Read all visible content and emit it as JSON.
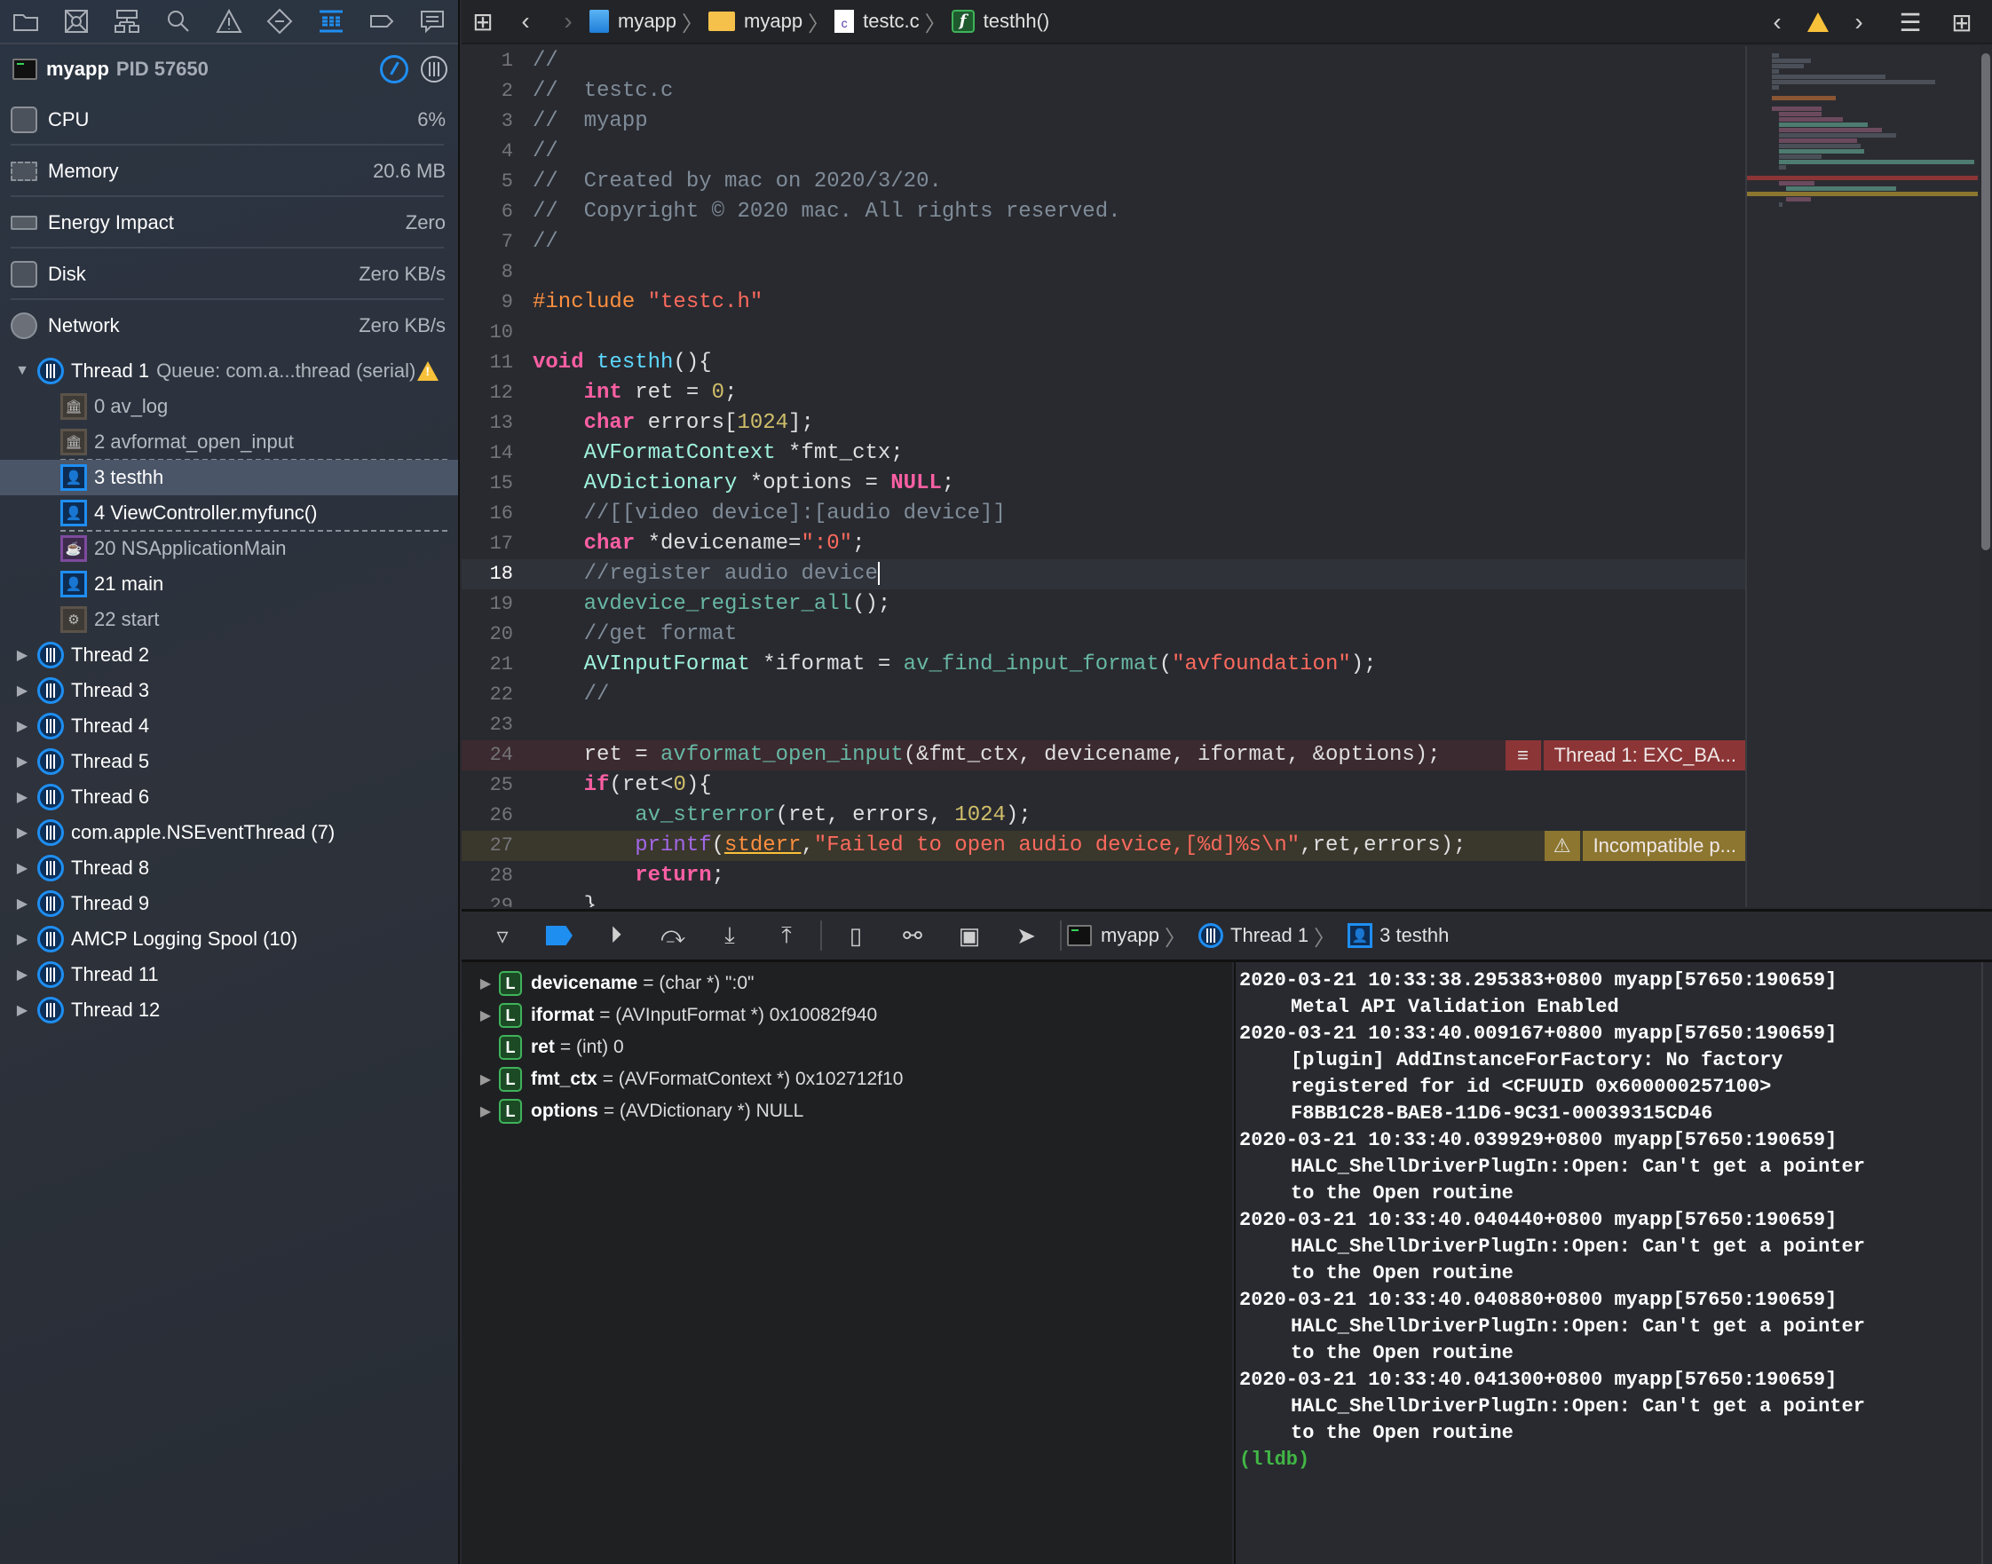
{
  "navigator": {
    "toolbar_icons": [
      "folder-icon",
      "source-control-icon",
      "symbol-icon",
      "find-icon",
      "issue-icon",
      "test-icon",
      "debug-icon",
      "breakpoint-icon",
      "report-icon"
    ],
    "active_icon": "debug-icon"
  },
  "process": {
    "name": "myapp",
    "pid": "PID 57650"
  },
  "gauges": [
    {
      "label": "CPU",
      "value": "6%",
      "icon": "cpu-icon"
    },
    {
      "label": "Memory",
      "value": "20.6 MB",
      "icon": "memory-icon"
    },
    {
      "label": "Energy Impact",
      "value": "Zero",
      "icon": "energy-icon"
    },
    {
      "label": "Disk",
      "value": "Zero KB/s",
      "icon": "disk-icon"
    },
    {
      "label": "Network",
      "value": "Zero KB/s",
      "icon": "network-icon"
    }
  ],
  "thread1": {
    "name": "Thread 1",
    "queue": "Queue: com.a...thread (serial)",
    "frames": [
      {
        "label": "0 av_log",
        "kind": "library"
      },
      {
        "label": "2 avformat_open_input",
        "kind": "library"
      },
      {
        "label": "3 testhh",
        "kind": "user",
        "selected": true
      },
      {
        "label": "4 ViewController.myfunc()",
        "kind": "user"
      },
      {
        "label": "20 NSApplicationMain",
        "kind": "framework"
      },
      {
        "label": "21 main",
        "kind": "user"
      },
      {
        "label": "22 start",
        "kind": "system"
      }
    ]
  },
  "threads": [
    "Thread 2",
    "Thread 3",
    "Thread 4",
    "Thread 5",
    "Thread 6",
    "com.apple.NSEventThread (7)",
    "Thread 8",
    "Thread 9",
    "AMCP Logging Spool (10)",
    "Thread 11",
    "Thread 12"
  ],
  "breadcrumb": {
    "project": "myapp",
    "folder": "myapp",
    "file": "testc.c",
    "file_icon_letter": "c",
    "symbol": "testhh()",
    "symbol_icon_letter": "f"
  },
  "code": {
    "current_line": 18,
    "lines": [
      {
        "n": "1",
        "html": "<span class='tok-cmt'>//</span>"
      },
      {
        "n": "2",
        "html": "<span class='tok-cmt'>//  testc.c</span>"
      },
      {
        "n": "3",
        "html": "<span class='tok-cmt'>//  myapp</span>"
      },
      {
        "n": "4",
        "html": "<span class='tok-cmt'>//</span>"
      },
      {
        "n": "5",
        "html": "<span class='tok-cmt'>//  Created by mac on 2020/3/20.</span>"
      },
      {
        "n": "6",
        "html": "<span class='tok-cmt'>//  Copyright © 2020 mac. All rights reserved.</span>"
      },
      {
        "n": "7",
        "html": "<span class='tok-cmt'>//</span>"
      },
      {
        "n": "8",
        "html": ""
      },
      {
        "n": "9",
        "html": "<span class='tok-pp'>#include</span> <span class='tok-str'>\"testc.h\"</span>"
      },
      {
        "n": "10",
        "html": ""
      },
      {
        "n": "11",
        "html": "<span class='tok-kw'>void</span> <span class='tok-decl'>testhh</span>(){"
      },
      {
        "n": "12",
        "html": "    <span class='tok-kw'>int</span> ret = <span class='tok-num'>0</span>;"
      },
      {
        "n": "13",
        "html": "    <span class='tok-kw'>char</span> errors[<span class='tok-num'>1024</span>];"
      },
      {
        "n": "14",
        "html": "    <span class='tok-type'>AVFormatContext</span> *fmt_ctx;"
      },
      {
        "n": "15",
        "html": "    <span class='tok-type'>AVDictionary</span> *options = <span class='tok-kw'>NULL</span>;"
      },
      {
        "n": "16",
        "html": "    <span class='tok-cmt'>//[[video device]:[audio device]]</span>"
      },
      {
        "n": "17",
        "html": "    <span class='tok-kw'>char</span> *devicename=<span class='tok-str'>\":0\"</span>;"
      },
      {
        "n": "18",
        "html": "    <span class='tok-cmt'>//register audio device</span><span class='caret'></span>",
        "state": "current"
      },
      {
        "n": "19",
        "html": "    <span class='tok-fn'>avdevice_register_all</span>();"
      },
      {
        "n": "20",
        "html": "    <span class='tok-cmt'>//get format</span>"
      },
      {
        "n": "21",
        "html": "    <span class='tok-type'>AVInputFormat</span> *iformat = <span class='tok-fn'>av_find_input_format</span>(<span class='tok-str'>\"avfoundation\"</span>);"
      },
      {
        "n": "22",
        "html": "    <span class='tok-cmt'>//</span>"
      },
      {
        "n": "23",
        "html": ""
      },
      {
        "n": "24",
        "html": "    ret = <span class='tok-fn'>avformat_open_input</span>(&amp;fmt_ctx, devicename, iformat, &amp;options);",
        "state": "error"
      },
      {
        "n": "25",
        "html": "    <span class='tok-kw'>if</span>(ret&lt;<span class='tok-num'>0</span>){"
      },
      {
        "n": "26",
        "html": "        <span class='tok-fn'>av_strerror</span>(ret, errors, <span class='tok-num'>1024</span>);"
      },
      {
        "n": "27",
        "html": "        <span class='tok-printf'>printf</span>(<span class='tok-macro'>stderr</span>,<span class='tok-str'>\"Failed to open audio device,[%d]%s\\n\"</span>,ret,errors);",
        "state": "warning"
      },
      {
        "n": "28",
        "html": "        <span class='tok-kw'>return</span>;"
      },
      {
        "n": "29",
        "html": "    }"
      }
    ]
  },
  "annotations": {
    "error": {
      "line": 24,
      "text": "Thread 1: EXC_BA...",
      "color": "#8b3536"
    },
    "warning": {
      "line": 27,
      "text": "Incompatible p...",
      "color": "#8c7630"
    }
  },
  "debug_bar": {
    "buttons": [
      "hide-debug-area",
      "breakpoints-toggle",
      "continue",
      "step-over",
      "step-into",
      "step-out",
      "view-debugger",
      "memory-graph",
      "environment-overrides",
      "simulate-location"
    ],
    "breadcrumb": {
      "process": "myapp",
      "thread": "Thread 1",
      "frame": "3 testhh"
    }
  },
  "variables": [
    {
      "name": "devicename",
      "detail": "= (char *) \":0\"",
      "expandable": true
    },
    {
      "name": "iformat",
      "detail": "= (AVInputFormat *) 0x10082f940",
      "expandable": true
    },
    {
      "name": "ret",
      "detail": "= (int) 0",
      "expandable": false
    },
    {
      "name": "fmt_ctx",
      "detail": "= (AVFormatContext *) 0x102712f10",
      "expandable": true
    },
    {
      "name": "options",
      "detail": "= (AVDictionary *) NULL",
      "expandable": true
    }
  ],
  "console": {
    "entries": [
      {
        "head": "2020-03-21 10:33:38.295383+0800 myapp[57650:190659]",
        "body": [
          "Metal API Validation Enabled"
        ]
      },
      {
        "head": "2020-03-21 10:33:40.009167+0800 myapp[57650:190659]",
        "body": [
          "[plugin] AddInstanceForFactory: No factory",
          "registered for id <CFUUID 0x600000257100>",
          "F8BB1C28-BAE8-11D6-9C31-00039315CD46"
        ]
      },
      {
        "head": "2020-03-21 10:33:40.039929+0800 myapp[57650:190659]",
        "body": [
          "HALC_ShellDriverPlugIn::Open: Can't get a pointer",
          "to the Open routine"
        ]
      },
      {
        "head": "2020-03-21 10:33:40.040440+0800 myapp[57650:190659]",
        "body": [
          "HALC_ShellDriverPlugIn::Open: Can't get a pointer",
          "to the Open routine"
        ]
      },
      {
        "head": "2020-03-21 10:33:40.040880+0800 myapp[57650:190659]",
        "body": [
          "HALC_ShellDriverPlugIn::Open: Can't get a pointer",
          "to the Open routine"
        ]
      },
      {
        "head": "2020-03-21 10:33:40.041300+0800 myapp[57650:190659]",
        "body": [
          "HALC_ShellDriverPlugIn::Open: Can't get a pointer",
          "to the Open routine"
        ]
      }
    ],
    "prompt": "(lldb)"
  },
  "colors": {
    "accent": "#1f8ef1",
    "error": "#8b3536",
    "warning": "#8c7630",
    "prompt": "#41b645"
  }
}
